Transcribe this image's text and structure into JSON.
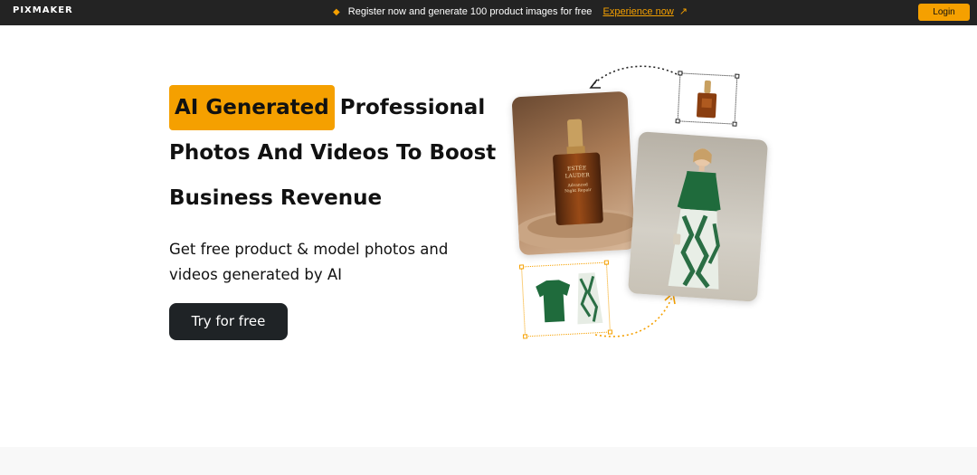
{
  "topbar": {
    "logo": "PIXMAKER",
    "promo_text": "Register now and generate 100 product images for free",
    "promo_link": "Experience now",
    "promo_arrow": "↗",
    "login_label": "Login",
    "spark_icon": "sparkle-icon"
  },
  "hero": {
    "headline_highlight": "AI Generated",
    "headline_line1_rest": "Professional",
    "headline_line2": "Photos And Videos To Boost",
    "headline_line3": "Business Revenue",
    "subtitle": "Get free product & model photos and videos generated by AI",
    "cta_label": "Try for free"
  },
  "colors": {
    "accent": "#f5a000",
    "topbar_bg": "#232323",
    "cta_bg": "#1f2326"
  },
  "collage": {
    "bottle_label_1": "ESTÉE",
    "bottle_label_2": "LAUDER",
    "bottle_label_3": "Advanced",
    "bottle_label_4": "Night Repair"
  }
}
